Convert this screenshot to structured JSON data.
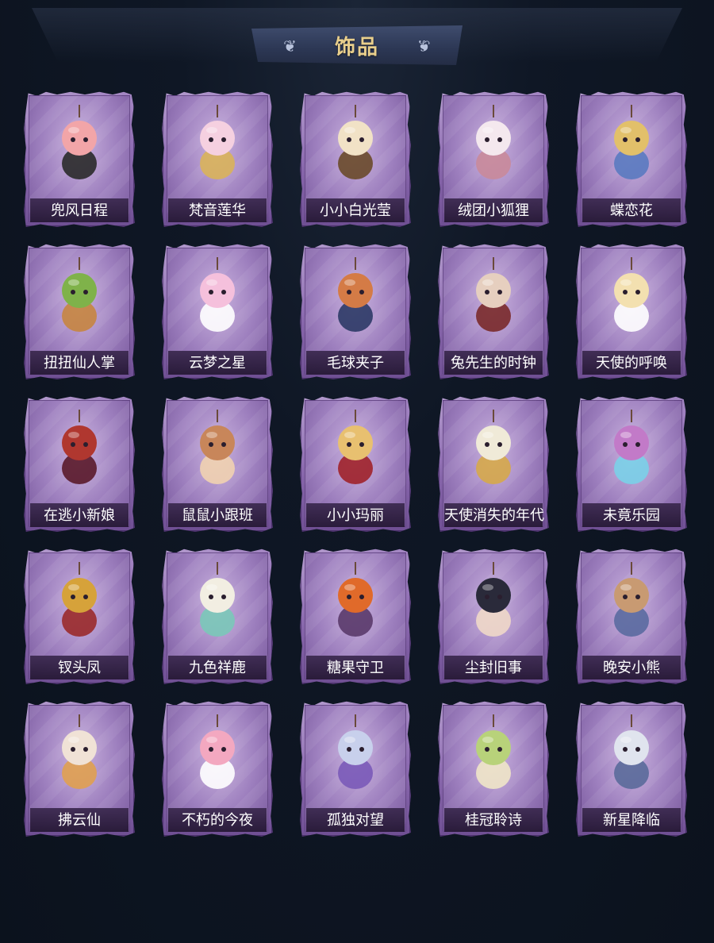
{
  "header": {
    "title": "饰品"
  },
  "colors": {
    "background": "#0d1420",
    "card_purple": "#8e6cb2",
    "title_gold": "#e9cf8c",
    "label_bg": "#3a284e"
  },
  "items": [
    {
      "name": "兜风日程",
      "icon": "pig-with-cap-icon",
      "c1": "#f2a5a8",
      "c2": "#2a2a2a"
    },
    {
      "name": "梵音莲华",
      "icon": "lotus-doll-icon",
      "c1": "#f5d0e0",
      "c2": "#d9b25a"
    },
    {
      "name": "小小白光莹",
      "icon": "crowned-doll-icon",
      "c1": "#f1e2c6",
      "c2": "#6a4a2a"
    },
    {
      "name": "绒团小狐狸",
      "icon": "white-fox-icon",
      "c1": "#f4e8ee",
      "c2": "#c98a9a"
    },
    {
      "name": "蝶恋花",
      "icon": "butterfly-bell-icon",
      "c1": "#e2c06a",
      "c2": "#5a7ac0"
    },
    {
      "name": "扭扭仙人掌",
      "icon": "cactus-pot-icon",
      "c1": "#7fb24a",
      "c2": "#c78540"
    },
    {
      "name": "云梦之星",
      "icon": "unicorn-cloud-icon",
      "c1": "#f5c0dc",
      "c2": "#ffffff"
    },
    {
      "name": "毛球夹子",
      "icon": "raccoon-drum-icon",
      "c1": "#d47b46",
      "c2": "#2c3a66"
    },
    {
      "name": "兔先生的时钟",
      "icon": "rabbit-clock-icon",
      "c1": "#e6cfbf",
      "c2": "#7a2a2a"
    },
    {
      "name": "天使的呼唤",
      "icon": "angel-doll-icon",
      "c1": "#f3e0b0",
      "c2": "#ffffff"
    },
    {
      "name": "在逃小新娘",
      "icon": "bride-veil-icon",
      "c1": "#b0372f",
      "c2": "#5a1a2a"
    },
    {
      "name": "鼠鼠小跟班",
      "icon": "hamster-icon",
      "c1": "#c8865a",
      "c2": "#f1d2b0"
    },
    {
      "name": "小小玛丽",
      "icon": "mary-doll-icon",
      "c1": "#e8c070",
      "c2": "#a0222a"
    },
    {
      "name": "天使消失的年代",
      "icon": "veiled-angel-icon",
      "c1": "#f0ead8",
      "c2": "#d6a84a"
    },
    {
      "name": "未竟乐园",
      "icon": "starry-girl-icon",
      "c1": "#c27ac8",
      "c2": "#7ad0e8"
    },
    {
      "name": "钗头凤",
      "icon": "phoenix-crown-icon",
      "c1": "#d6a23a",
      "c2": "#9a2a2a"
    },
    {
      "name": "九色祥鹿",
      "icon": "white-deer-icon",
      "c1": "#f2eee2",
      "c2": "#7ac8b8"
    },
    {
      "name": "糖果守卫",
      "icon": "pumpkin-guard-icon",
      "c1": "#e06a2a",
      "c2": "#5a3a6a"
    },
    {
      "name": "尘封旧事",
      "icon": "gentleman-doll-icon",
      "c1": "#2a2a3a",
      "c2": "#f0d8c8"
    },
    {
      "name": "晚安小熊",
      "icon": "teddy-bear-icon",
      "c1": "#c89a72",
      "c2": "#5a6aa0"
    },
    {
      "name": "拂云仙",
      "icon": "cloud-immortal-icon",
      "c1": "#f0e2d6",
      "c2": "#e0a050"
    },
    {
      "name": "不朽的今夜",
      "icon": "pink-cat-bowl-icon",
      "c1": "#f3a8c0",
      "c2": "#ffffff"
    },
    {
      "name": "孤独对望",
      "icon": "silver-hair-doll-icon",
      "c1": "#c8d0ec",
      "c2": "#7a5ab8"
    },
    {
      "name": "桂冠聆诗",
      "icon": "laurel-doll-icon",
      "c1": "#b8d27a",
      "c2": "#f0e6c8"
    },
    {
      "name": "新星降临",
      "icon": "white-hair-doll-icon",
      "c1": "#e0e4ee",
      "c2": "#5a6a9a"
    }
  ]
}
